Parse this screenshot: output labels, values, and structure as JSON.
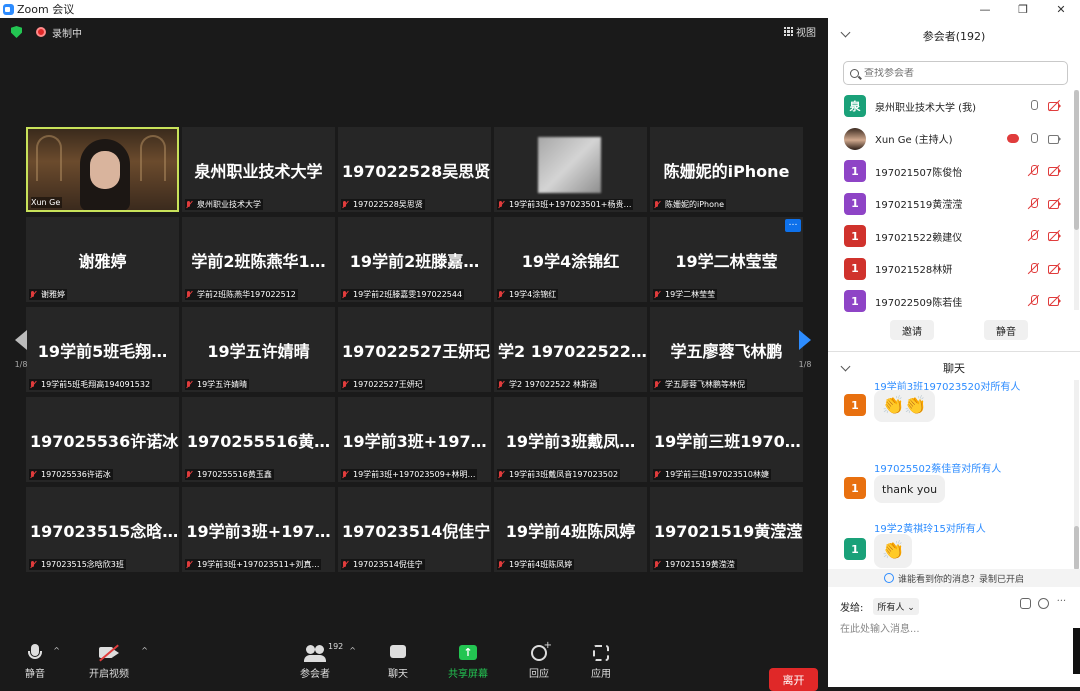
{
  "window": {
    "title": "Zoom 会议",
    "controls": [
      "—",
      "❐",
      "✕"
    ]
  },
  "meeting": {
    "recording_label": "录制中",
    "view_label": "视图",
    "page_left": "1/8",
    "page_right": "1/8",
    "tiles": [
      {
        "name": "",
        "label": "Xun Ge",
        "video": true
      },
      {
        "name": "泉州职业技术大学",
        "label": "泉州职业技术大学"
      },
      {
        "name": "197022528吴思贤",
        "label": "197022528吴思贤"
      },
      {
        "name": "",
        "label": "19学前3班+197023501+杨贵…",
        "thumb": true
      },
      {
        "name": "陈姗妮的iPhone",
        "label": "陈姗妮的iPhone"
      },
      {
        "name": "谢雅婷",
        "label": "谢雅婷"
      },
      {
        "name": "学前2班陈燕华1…",
        "label": "学前2班陈燕华197022512"
      },
      {
        "name": "19学前2班滕嘉…",
        "label": "19学前2班滕嘉雯197022544"
      },
      {
        "name": "19学4涂锦红",
        "label": "19学4涂锦红"
      },
      {
        "name": "19学二林莹莹",
        "label": "19学二林莹莹",
        "more": "…"
      },
      {
        "name": "19学前5班毛翔…",
        "label": "19学前5班毛翔高194091532"
      },
      {
        "name": "19学五许婧晴",
        "label": "19学五许婧晴"
      },
      {
        "name": "197022527王妍玘",
        "label": "197022527王妍玘"
      },
      {
        "name": "学2  197022522…",
        "label": "学2 197022522 林斯涵"
      },
      {
        "name": "学五廖蓉飞林鹏",
        "label": "学五廖蓉飞林鹏等林倪"
      },
      {
        "name": "197025536许诺冰",
        "label": "197025536许诺冰"
      },
      {
        "name": "197025551​6黄…",
        "label": "197025551​6黄玉鑫"
      },
      {
        "name": "19学前3班+197…",
        "label": "19学前3班+197023509+林明…"
      },
      {
        "name": "19学前3班戴凤…",
        "label": "19学前3班戴凤音197023502"
      },
      {
        "name": "19学前三班1970…",
        "label": "19学前三班197023510林婕"
      },
      {
        "name": "197023515念晗…",
        "label": "197023515念晗欣3班"
      },
      {
        "name": "19学前3班+197…",
        "label": "19学前3班+197023511+刘真…"
      },
      {
        "name": "197023514倪佳宁",
        "label": "197023514倪佳宁"
      },
      {
        "name": "19学前4班陈凤婷",
        "label": "19学前4班陈凤婷"
      },
      {
        "name": "197021519黄滢滢",
        "label": "197021519黄滢滢"
      }
    ]
  },
  "toolbar": {
    "mute": "静音",
    "video": "开启视频",
    "participants": "参会者",
    "participants_count": "192",
    "chat": "聊天",
    "share": "共享屏幕",
    "reactions": "回应",
    "apps": "应用",
    "leave": "离开"
  },
  "participants_panel": {
    "title": "参会者(192)",
    "search_placeholder": "查找参会者",
    "list": [
      {
        "avatar": "泉",
        "color": "#1aa179",
        "name": "泉州职业技术大学 (我)",
        "mic_muted": false,
        "cam_muted": true
      },
      {
        "avatar": "",
        "color": "photo",
        "name": "Xun Ge (主持人)",
        "mic_muted": false,
        "cam_muted": false,
        "cloud": true
      },
      {
        "avatar": "1",
        "color": "#8e44c6",
        "name": "197021507陈俊怡",
        "mic_muted": true,
        "cam_muted": true
      },
      {
        "avatar": "1",
        "color": "#8e44c6",
        "name": "197021519黄滢滢",
        "mic_muted": true,
        "cam_muted": true
      },
      {
        "avatar": "1",
        "color": "#d0322c",
        "name": "197021522赖建仪",
        "mic_muted": true,
        "cam_muted": true
      },
      {
        "avatar": "1",
        "color": "#d0322c",
        "name": "197021528林妍",
        "mic_muted": true,
        "cam_muted": true
      },
      {
        "avatar": "1",
        "color": "#8e44c6",
        "name": "197022509陈若佳",
        "mic_muted": true,
        "cam_muted": true
      }
    ],
    "invite": "邀请",
    "mute_all": "静音"
  },
  "chat_panel": {
    "title": "聊天",
    "messages": [
      {
        "from": "19学前3班197023520",
        "to": "对所有人",
        "avatar": "1",
        "color": "#e8700f",
        "content": "👏👏",
        "partial": true
      },
      {
        "from": "197025502蔡佳音",
        "to": "对所有人",
        "avatar": "1",
        "color": "#e8700f",
        "content": "thank you"
      },
      {
        "from": "19学2黄祺玲15",
        "to": "对所有人",
        "avatar": "1",
        "color": "#1aa179",
        "content": "👏"
      }
    ],
    "notice": "谁能看到你的消息？录制已开启",
    "send_to_label": "发给:",
    "send_to_value": "所有人",
    "input_placeholder": "在此处输入消息..."
  }
}
